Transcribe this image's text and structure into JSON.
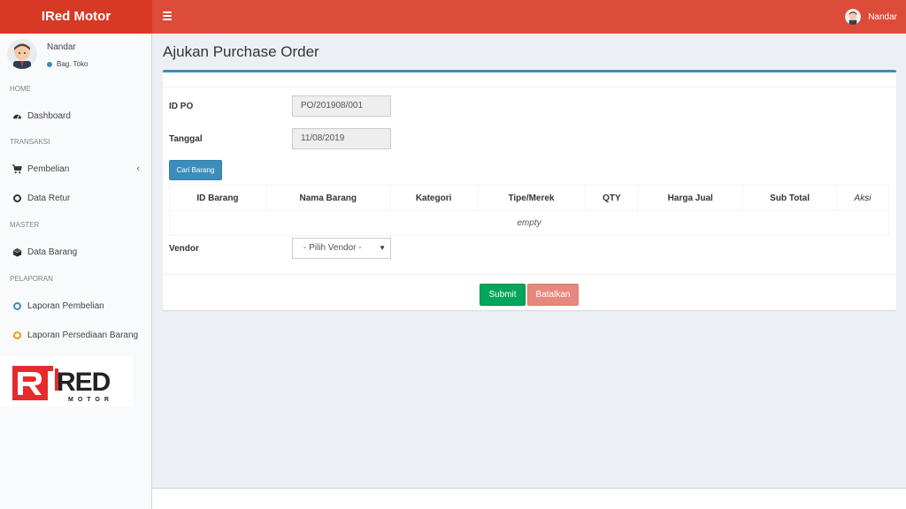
{
  "app": {
    "brand": "IRed Motor"
  },
  "header": {
    "user_name": "Nandar"
  },
  "sidebar": {
    "user": {
      "name": "Nandar",
      "role": "Bag. Toko"
    },
    "sections": {
      "home": "HOME",
      "transaksi": "TRANSAKSI",
      "master": "MASTER",
      "pelaporan": "PELAPORAN"
    },
    "items": {
      "dashboard": "Dashboard",
      "pembelian": "Pembelian",
      "data_retur": "Data Retur",
      "data_barang": "Data Barang",
      "laporan_pembelian": "Laporan Pembelian",
      "laporan_persediaan": "Laporan Persediaan Barang"
    },
    "logo_text": {
      "main": "iRED",
      "sub": "MOTOR"
    }
  },
  "page": {
    "title": "Ajukan Purchase Order"
  },
  "form": {
    "id_po_label": "ID PO",
    "id_po_value": "PO/201908/001",
    "tanggal_label": "Tanggal",
    "tanggal_value": "11/08/2019",
    "cari_barang": "Cari Barang",
    "vendor_label": "Vendor",
    "vendor_selected": "- Pilih Vendor -"
  },
  "table": {
    "headers": {
      "id_barang": "ID Barang",
      "nama_barang": "Nama Barang",
      "kategori": "Kategori",
      "tipe_merek": "Tipe/Merek",
      "qty": "QTY",
      "harga_jual": "Harga Jual",
      "sub_total": "Sub Total",
      "aksi": "Aksi"
    },
    "empty_text": "empty"
  },
  "actions": {
    "submit": "Submit",
    "cancel": "Batalkan"
  },
  "colors": {
    "header": "#dd4b39",
    "brand": "#d73925",
    "primary": "#3c8dbc",
    "success": "#00a65a",
    "danger_light": "#e8877d"
  }
}
